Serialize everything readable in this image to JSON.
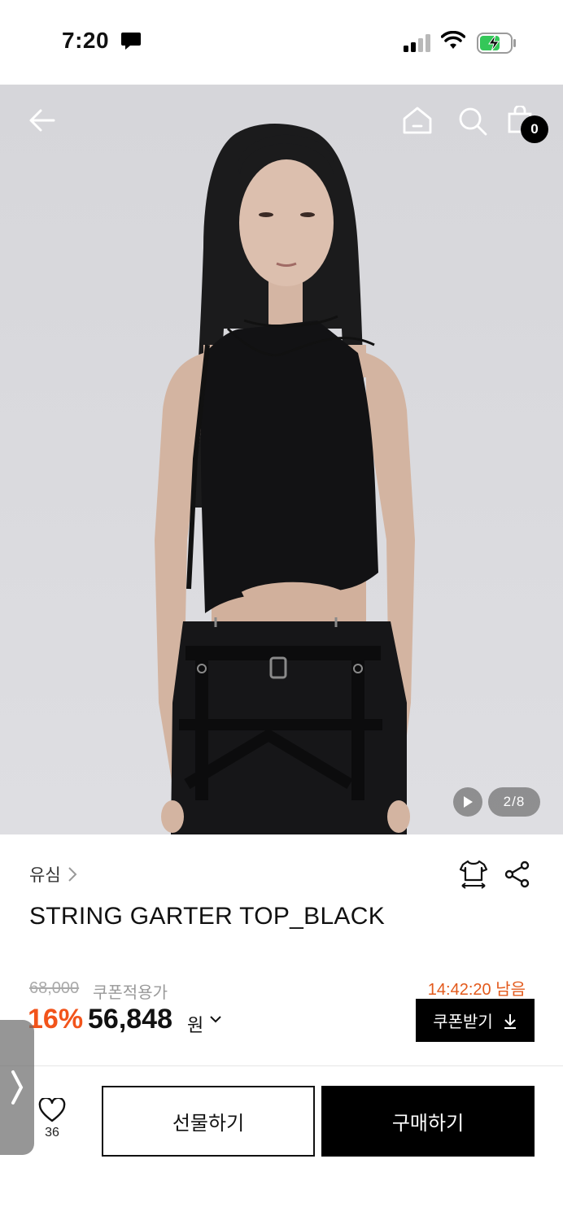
{
  "status_bar": {
    "time": "7:20"
  },
  "hero": {
    "counter": "2/8",
    "cart_count": "0"
  },
  "product": {
    "brand": "유심",
    "title": "STRING GARTER TOP_BLACK",
    "original_price": "68,000",
    "coupon_price_label": "쿠폰적용가",
    "timer": "14:42:20 남음",
    "discount": "16%",
    "sale_price": "56,848",
    "currency": "원",
    "coupon_button": "쿠폰받기"
  },
  "actions": {
    "like_count": "36",
    "gift_label": "선물하기",
    "buy_label": "구매하기"
  },
  "colors": {
    "accent": "#f2541b",
    "timer": "#e35a1c",
    "primary": "#000000"
  },
  "icons": [
    "back-arrow-icon",
    "home-icon",
    "search-icon",
    "shopping-bag-icon",
    "play-icon",
    "chevron-right-icon",
    "size-guide-icon",
    "share-icon",
    "chevron-down-icon",
    "download-icon",
    "heart-icon"
  ]
}
